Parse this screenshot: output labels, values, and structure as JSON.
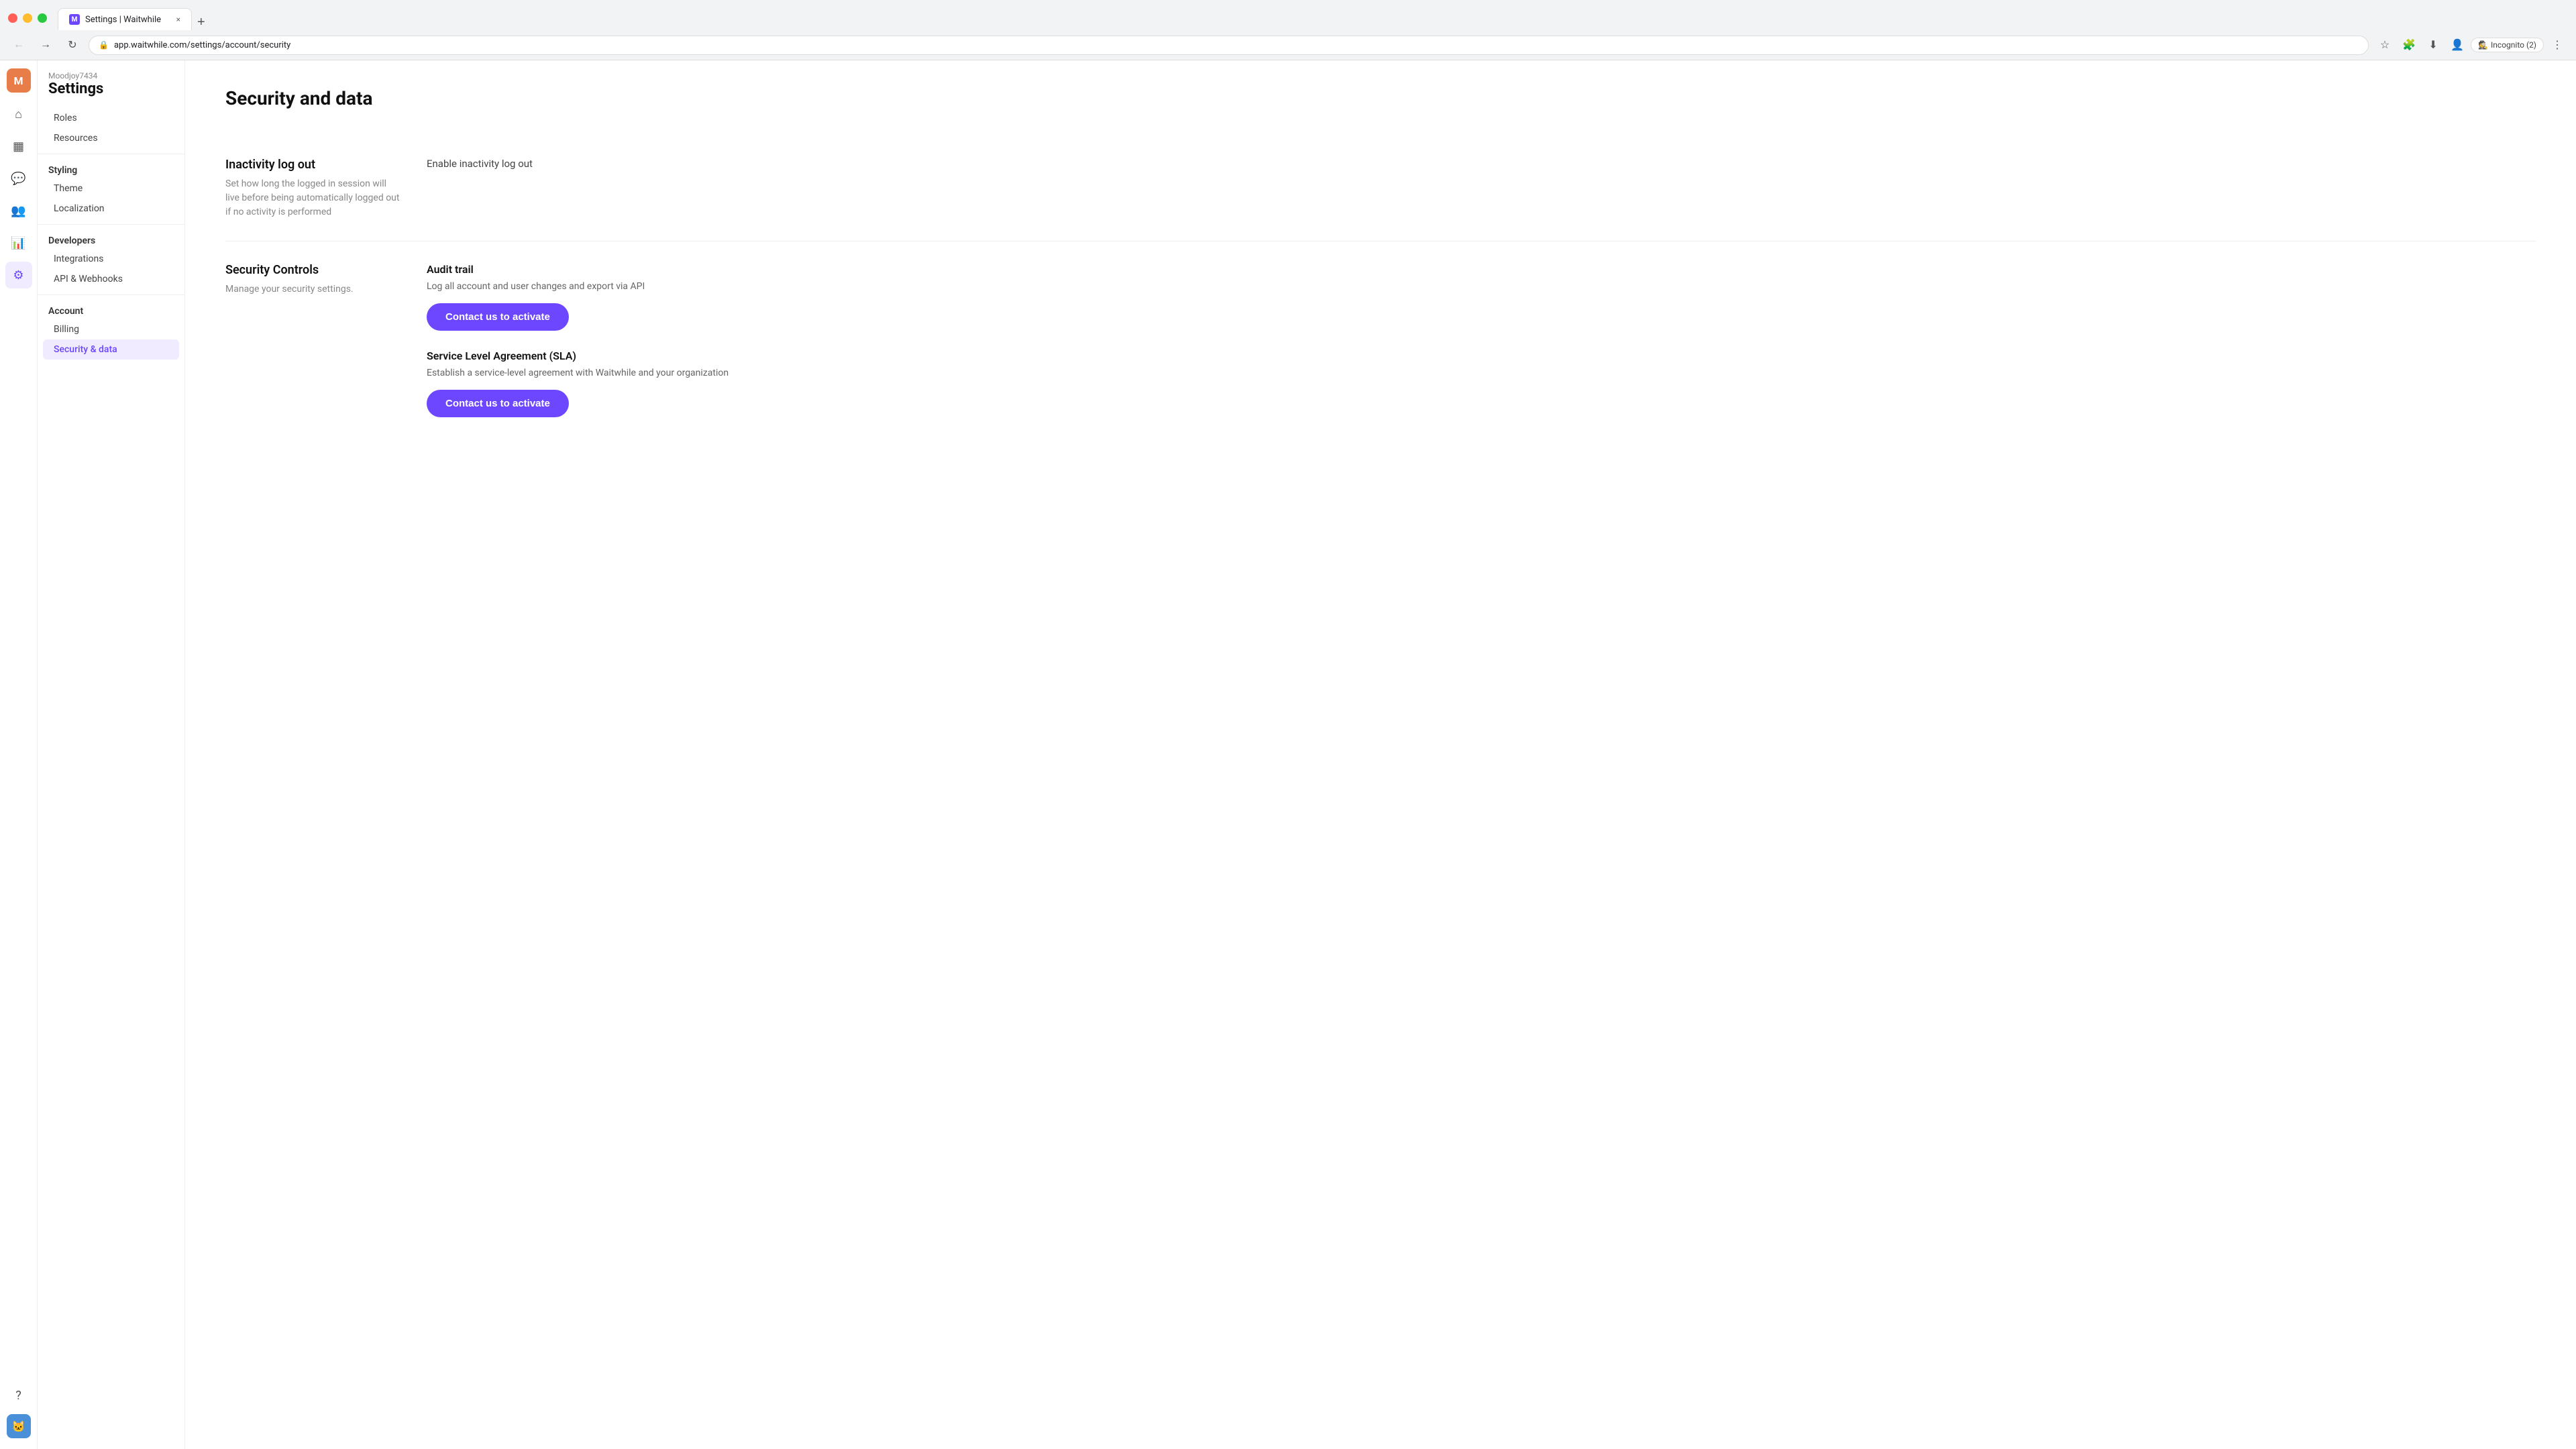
{
  "browser": {
    "tab_favicon": "M",
    "tab_title": "Settings | Waitwhile",
    "tab_close": "×",
    "new_tab": "+",
    "url": "app.waitwhile.com/settings/account/security",
    "incognito_label": "Incognito (2)"
  },
  "nav_icons": [
    {
      "id": "home-icon",
      "symbol": "⌂",
      "active": false
    },
    {
      "id": "calendar-icon",
      "symbol": "▦",
      "active": false
    },
    {
      "id": "chat-icon",
      "symbol": "💬",
      "active": false
    },
    {
      "id": "team-icon",
      "symbol": "👥",
      "active": false
    },
    {
      "id": "chart-icon",
      "symbol": "📊",
      "active": false
    },
    {
      "id": "settings-icon",
      "symbol": "⚙",
      "active": true
    },
    {
      "id": "help-icon",
      "symbol": "?",
      "active": false
    }
  ],
  "sidebar": {
    "username": "Moodjoy7434",
    "title": "Settings",
    "items_above": [
      {
        "id": "roles",
        "label": "Roles",
        "active": false
      },
      {
        "id": "resources",
        "label": "Resources",
        "active": false
      }
    ],
    "styling_label": "Styling",
    "styling_items": [
      {
        "id": "theme",
        "label": "Theme",
        "active": false
      },
      {
        "id": "localization",
        "label": "Localization",
        "active": false
      }
    ],
    "developers_label": "Developers",
    "developers_items": [
      {
        "id": "integrations",
        "label": "Integrations",
        "active": false
      },
      {
        "id": "api-webhooks",
        "label": "API & Webhooks",
        "active": false
      }
    ],
    "account_label": "Account",
    "account_items": [
      {
        "id": "billing",
        "label": "Billing",
        "active": false
      },
      {
        "id": "security-data",
        "label": "Security & data",
        "active": true
      }
    ]
  },
  "main": {
    "page_title": "Security and data",
    "sections": [
      {
        "id": "inactivity",
        "title": "Inactivity log out",
        "desc": "Set how long the logged in session will live before being automatically logged out if no activity is performed",
        "items": [
          {
            "label": "Enable inactivity log out"
          }
        ]
      },
      {
        "id": "security-controls",
        "title": "Security Controls",
        "desc": "Manage your security settings.",
        "sub_sections": [
          {
            "title": "Audit trail",
            "desc": "Log all account and user changes and export via API",
            "button": "Contact us to activate"
          },
          {
            "title": "Service Level Agreement (SLA)",
            "desc": "Establish a service-level agreement with Waitwhile and your organization",
            "button": "Contact us to activate"
          }
        ]
      }
    ]
  }
}
